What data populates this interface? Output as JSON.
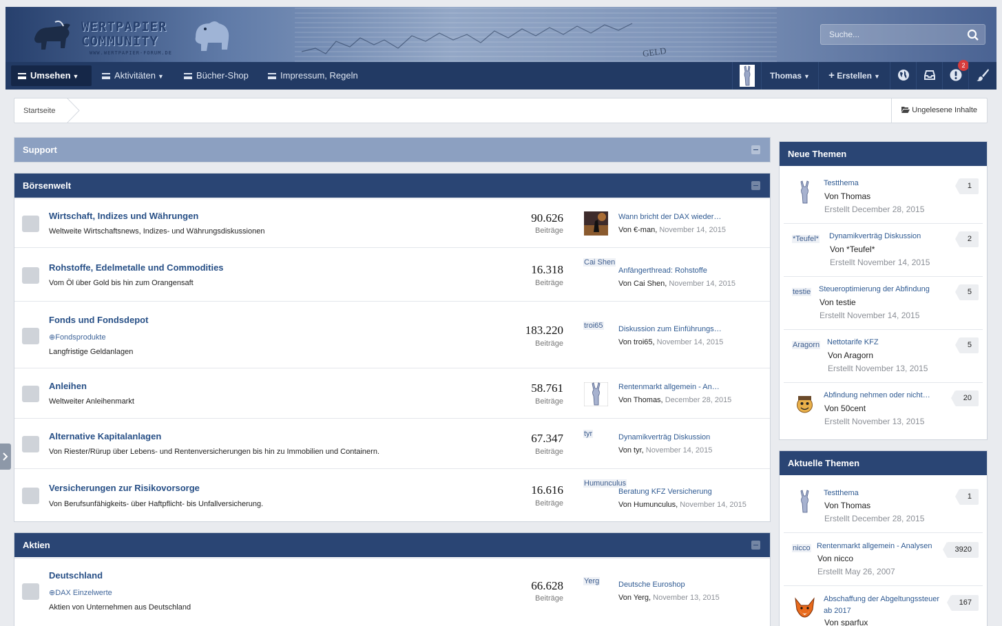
{
  "header": {
    "logo_line1": "WERTPAPIER",
    "logo_line2": "COMMUNITY",
    "logo_url": "WWW.WERTPAPIER-FORUM.DE",
    "banner_word": "GELD",
    "search_placeholder": "Suche..."
  },
  "nav": {
    "items": [
      {
        "label": "Umsehen"
      },
      {
        "label": "Aktivitäten"
      },
      {
        "label": "Bücher-Shop"
      },
      {
        "label": "Impressum, Regeln"
      }
    ],
    "user": "Thomas",
    "create": "Erstellen",
    "notification_count": "2"
  },
  "breadcrumb": {
    "home": "Startseite",
    "unread": "Ungelesene Inhalte"
  },
  "categories": [
    {
      "name": "Support",
      "collapsed": true
    },
    {
      "name": "Börsenwelt",
      "forums": [
        {
          "title": "Wirtschaft, Indizes und Währungen",
          "sub": "",
          "desc": "Weltweite Wirtschaftsnews, Indizes- und Währungsdiskussionen",
          "count": "90.626",
          "count_label": "Beiträge",
          "avatar": "image",
          "last_title": "Wann bricht der DAX wieder…",
          "last_by": "Von €-man,",
          "last_date": "November 14, 2015"
        },
        {
          "title": "Rohstoffe, Edelmetalle und Commodities",
          "sub": "",
          "desc": "Vom Öl über Gold bis hin zum Orangensaft",
          "count": "16.318",
          "count_label": "Beiträge",
          "avatar_name": "Cai Shen",
          "last_title": "Anfängerthread: Rohstoffe",
          "last_by": "Von Cai Shen,",
          "last_date": "November 14, 2015"
        },
        {
          "title": "Fonds und Fondsdepot",
          "sub": "Fondsprodukte",
          "desc": "Langfristige Geldanlagen",
          "count": "183.220",
          "count_label": "Beiträge",
          "avatar_name": "troi65",
          "last_title": "Diskussion zum Einführungs…",
          "last_by": "Von troi65,",
          "last_date": "November 14, 2015"
        },
        {
          "title": "Anleihen",
          "sub": "",
          "desc": "Weltweiter Anleihenmarkt",
          "count": "58.761",
          "count_label": "Beiträge",
          "avatar": "rabbit",
          "last_title": "Rentenmarkt allgemein - An…",
          "last_by": "Von Thomas,",
          "last_date": "December 28, 2015"
        },
        {
          "title": "Alternative Kapitalanlagen",
          "sub": "",
          "desc": "Von Riester/Rürup über Lebens- und Rentenversicherungen bis hin zu Immobilien und Containern.",
          "count": "67.347",
          "count_label": "Beiträge",
          "avatar_name": "tyr",
          "last_title": "Dynamikverträg Diskussion",
          "last_by": "Von tyr,",
          "last_date": "November 14, 2015"
        },
        {
          "title": "Versicherungen zur Risikovorsorge",
          "sub": "",
          "desc": "Von Berufsunfähigkeits- über Haftpflicht- bis Unfallversicherung.",
          "count": "16.616",
          "count_label": "Beiträge",
          "avatar_name": "Humunculus",
          "last_title": "Beratung KFZ Versicherung",
          "last_by": "Von Humunculus,",
          "last_date": "November 14, 2015"
        }
      ]
    },
    {
      "name": "Aktien",
      "forums": [
        {
          "title": "Deutschland",
          "sub": "DAX Einzelwerte",
          "desc": "Aktien von Unternehmen aus Deutschland",
          "count": "66.628",
          "count_label": "Beiträge",
          "avatar_name": "Yerg",
          "last_title": "Deutsche Euroshop",
          "last_by": "Von Yerg,",
          "last_date": "November 13, 2015"
        }
      ]
    }
  ],
  "sidebar": {
    "new_topics": {
      "title": "Neue Themen",
      "items": [
        {
          "avatar": "rabbit",
          "avatar_name": "",
          "title": "Testthema",
          "by": "Von Thomas",
          "date": "Erstellt December 28, 2015",
          "count": "1"
        },
        {
          "avatar_name": "*Teufel*",
          "title": "Dynamikverträg Diskussion",
          "by": "Von *Teufel*",
          "date": "Erstellt November 14, 2015",
          "count": "2"
        },
        {
          "avatar_name": "testie",
          "title": "Steueroptimierung der Abfindung",
          "by": "Von testie",
          "date": "Erstellt November 14, 2015",
          "count": "5"
        },
        {
          "avatar_name": "Aragorn",
          "title": "Nettotarife KFZ",
          "by": "Von Aragorn",
          "date": "Erstellt November 13, 2015",
          "count": "5"
        },
        {
          "avatar": "smiley",
          "avatar_name": "",
          "title": "Abfindung nehmen oder nicht…",
          "by": "Von 50cent",
          "date": "Erstellt November 13, 2015",
          "count": "20"
        }
      ]
    },
    "current_topics": {
      "title": "Aktuelle Themen",
      "items": [
        {
          "avatar": "rabbit",
          "avatar_name": "",
          "title": "Testthema",
          "by": "Von Thomas",
          "date": "Erstellt December 28, 2015",
          "count": "1"
        },
        {
          "avatar_name": "nicco",
          "title": "Rentenmarkt allgemein - Analysen",
          "by": "Von nicco",
          "date": "Erstellt May 26, 2007",
          "count": "3920"
        },
        {
          "avatar": "fox",
          "avatar_name": "",
          "title": "Abschaffung der Abgeltungssteuer ab 2017",
          "by": "Von sparfux",
          "date": "",
          "count": "167"
        }
      ]
    }
  },
  "colors": {
    "nav": "#223a64",
    "header_accent": "#2a4574",
    "link": "#274f86"
  }
}
